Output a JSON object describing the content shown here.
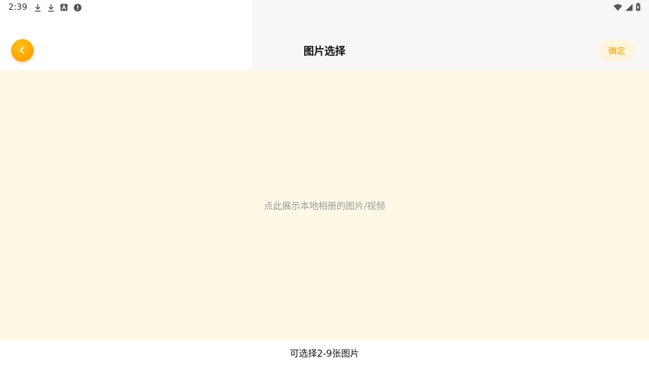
{
  "status_bar": {
    "time": "2:39",
    "left_icons": [
      "download-icon",
      "download-icon",
      "app-store-icon",
      "alert-icon"
    ],
    "right_icons": [
      "wifi-icon",
      "cell-signal-icon",
      "battery-icon"
    ]
  },
  "header": {
    "title": "图片选择",
    "back_icon": "chevron-left-icon",
    "confirm_label": "确定"
  },
  "gallery": {
    "hint": "点此展示本地相册的图片/视频"
  },
  "footer": {
    "hint": "可选择2-9张图片"
  },
  "colors": {
    "accent": "#ffa600",
    "confirm_text": "#f5a000",
    "confirm_bg": "#fff4dc",
    "gallery_bg": "#fef8e5"
  }
}
